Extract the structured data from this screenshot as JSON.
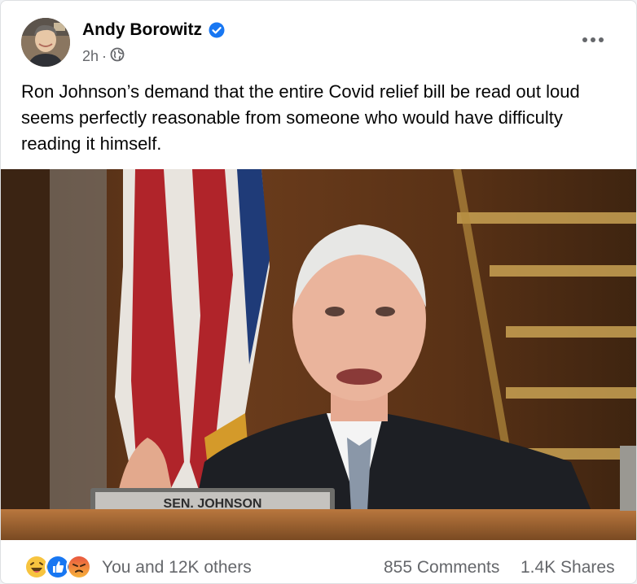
{
  "post": {
    "author": "Andy Borowitz",
    "time": "2h",
    "separator": "·",
    "privacy_icon": "globe-icon",
    "verified_icon": "verified-badge-icon",
    "more_icon": "more-options-icon",
    "text": "Ron Johnson’s demand that the entire Covid relief bill be read out loud seems perfectly reasonable from someone who would have difficulty reading it himself.",
    "image": {
      "nameplate": "SEN. JOHNSON"
    }
  },
  "footer": {
    "reaction_icons": [
      "haha-icon",
      "like-icon",
      "angry-icon"
    ],
    "reactions_label": "You and 12K others",
    "comments": "855 Comments",
    "shares": "1.4K Shares"
  },
  "colors": {
    "accent": "#1877f2",
    "text": "#050505",
    "secondary": "#65676b"
  }
}
